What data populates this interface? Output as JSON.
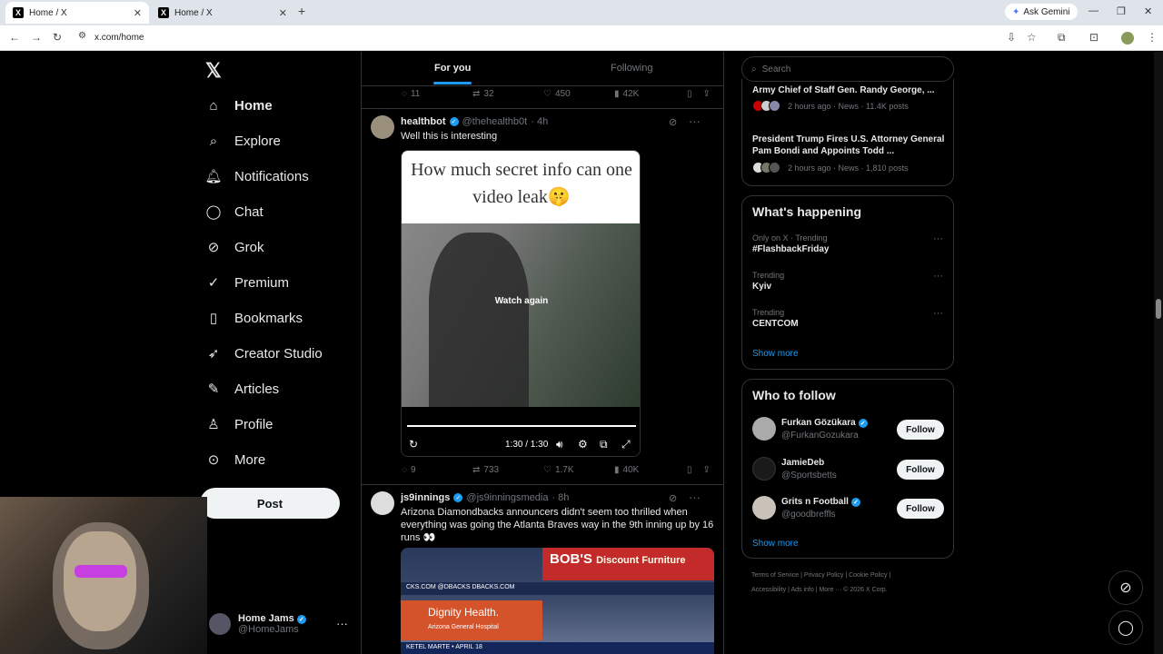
{
  "browser": {
    "tabs": [
      {
        "title": "Home / X"
      },
      {
        "title": "Home / X"
      }
    ],
    "gemini": "Ask Gemini",
    "url": "x.com/home"
  },
  "nav": {
    "items": [
      {
        "label": "Home"
      },
      {
        "label": "Explore"
      },
      {
        "label": "Notifications"
      },
      {
        "label": "Chat"
      },
      {
        "label": "Grok"
      },
      {
        "label": "Premium"
      },
      {
        "label": "Bookmarks"
      },
      {
        "label": "Creator Studio"
      },
      {
        "label": "Articles"
      },
      {
        "label": "Profile"
      },
      {
        "label": "More"
      }
    ],
    "post": "Post",
    "account": {
      "name": "Home Jams",
      "handle": "@HomeJams"
    }
  },
  "feed": {
    "tabs": [
      "For you",
      "Following"
    ],
    "prev_actions": {
      "replies": "11",
      "reposts": "32",
      "likes": "450",
      "views": "42K"
    },
    "tweet1": {
      "name": "healthbot",
      "handle": "@thehealthb0t",
      "time": "· 4h",
      "text": "Well this is interesting",
      "video_caption": "How much secret info can one video leak🤫",
      "watch_again": "Watch again",
      "video_time": "1:30 / 1:30",
      "actions": {
        "replies": "9",
        "reposts": "733",
        "likes": "1.7K",
        "views": "40K"
      }
    },
    "tweet2": {
      "name": "js9innings",
      "handle": "@js9inningsmedia",
      "time": "· 8h",
      "text": "Arizona Diamondbacks announcers didn't seem too thrilled when everything was going the Atlanta Braves way in the 9th inning up by 16 runs 👀",
      "banner": "BOB'S",
      "banner_sub": "Discount Furniture",
      "sponsor": "Dignity Health.",
      "sponsor_sub": "Arizona General Hospital",
      "strip": "KETEL MARTE • APRIL 18",
      "dbacks": "CKS.COM   @DBACKS   DBACKS.COM"
    }
  },
  "sidebar": {
    "search_placeholder": "Search",
    "news": [
      {
        "title": "Army Chief of Staff Gen. Randy George, ...",
        "meta": "2 hours ago · News · 11.4K posts"
      },
      {
        "title": "President Trump Fires U.S. Attorney General Pam Bondi and Appoints Todd ...",
        "meta": "2 hours ago · News · 1,810 posts"
      }
    ],
    "happening": {
      "title": "What's happening",
      "items": [
        {
          "meta": "Only on X · Trending",
          "name": "#FlashbackFriday"
        },
        {
          "meta": "Trending",
          "name": "Kyiv"
        },
        {
          "meta": "Trending",
          "name": "CENTCOM"
        }
      ],
      "show_more": "Show more"
    },
    "who_to_follow": {
      "title": "Who to follow",
      "items": [
        {
          "name": "Furkan Gözükara",
          "handle": "@FurkanGozukara",
          "verified": true
        },
        {
          "name": "JamieDeb",
          "handle": "@Sportsbetts",
          "verified": false
        },
        {
          "name": "Grits n Football",
          "handle": "@goodbreffls",
          "verified": true
        }
      ],
      "follow": "Follow",
      "show_more": "Show more"
    },
    "footer": {
      "line1": "Terms of Service  |  Privacy Policy  |  Cookie Policy  |",
      "line2": "Accessibility  |  Ads info  |  More ···  © 2026 X Corp."
    }
  },
  "colors": {
    "accent": "#1d9bf0",
    "bg": "#000000",
    "border": "#2f3336"
  }
}
